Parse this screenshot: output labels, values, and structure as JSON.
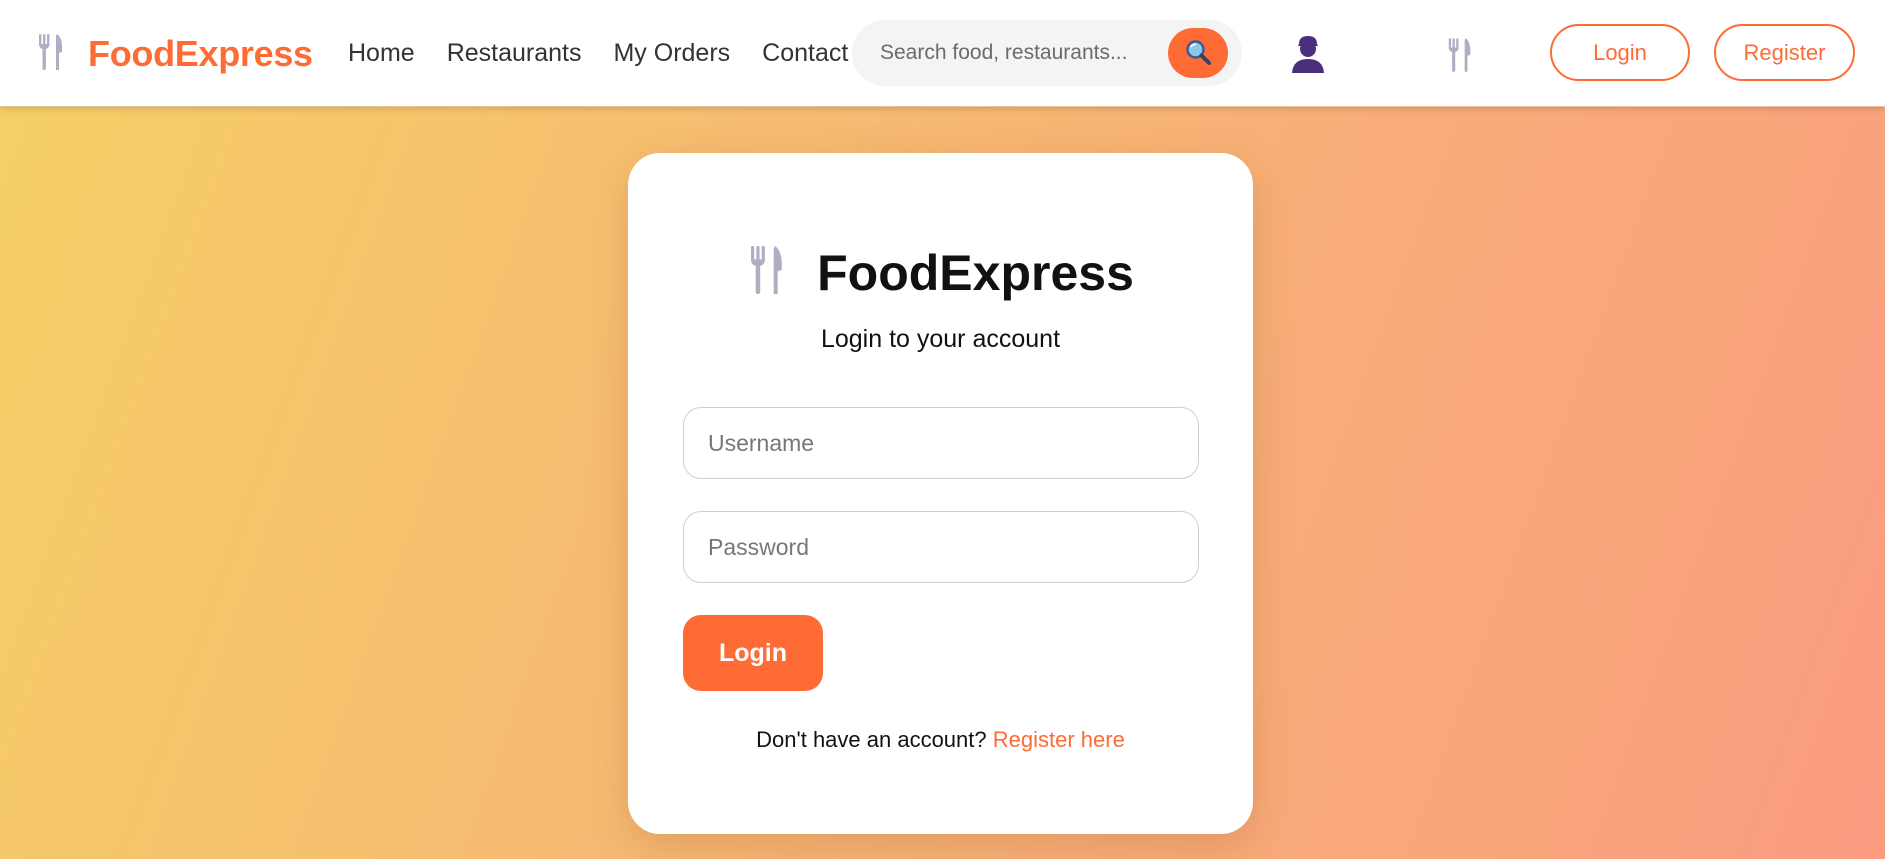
{
  "navbar": {
    "brand": "FoodExpress",
    "brand_icon": "fork-and-knife-icon",
    "links": [
      "Home",
      "Restaurants",
      "My Orders",
      "Contact"
    ],
    "search_placeholder": "Search food, restaurants...",
    "search_icon": "magnifying-glass-icon",
    "user_icon": "user-silhouette-icon",
    "secondary_icon": "fork-and-knife-icon",
    "login_label": "Login",
    "register_label": "Register"
  },
  "login_card": {
    "icon": "fork-and-knife-icon",
    "title": "FoodExpress",
    "subtitle": "Login to your account",
    "username_placeholder": "Username",
    "password_placeholder": "Password",
    "submit_label": "Login",
    "register_prompt": "Don't have an account?",
    "register_link": "Register here"
  },
  "colors": {
    "accent": "#ff6b35",
    "icon_gray": "#b3adc4",
    "user_icon": "#4b2f7c",
    "gradient_start": "#f5cf64",
    "gradient_end": "#fb9c80"
  }
}
